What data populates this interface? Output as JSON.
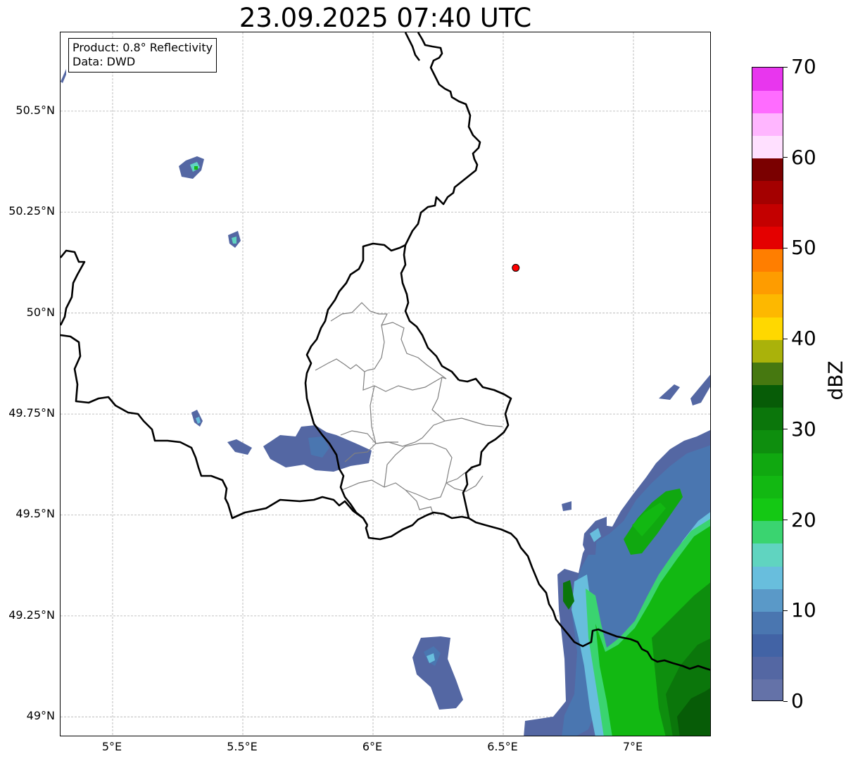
{
  "title": "23.09.2025 07:40 UTC",
  "info_box": {
    "product": "Product: 0.8° Reflectivity",
    "data": "Data: DWD"
  },
  "map": {
    "extent": {
      "lon": [
        4.8,
        7.3
      ],
      "lat": [
        48.95,
        50.695
      ]
    },
    "lat_ticks": [
      {
        "value": 50.5,
        "label": "50.5°N"
      },
      {
        "value": 50.25,
        "label": "50.25°N"
      },
      {
        "value": 50.0,
        "label": "50°N"
      },
      {
        "value": 49.75,
        "label": "49.75°N"
      },
      {
        "value": 49.5,
        "label": "49.5°N"
      },
      {
        "value": 49.25,
        "label": "49.25°N"
      },
      {
        "value": 49.0,
        "label": "49°N"
      }
    ],
    "lon_ticks": [
      {
        "value": 5.0,
        "label": "5°E"
      },
      {
        "value": 5.5,
        "label": "5.5°E"
      },
      {
        "value": 6.0,
        "label": "6°E"
      },
      {
        "value": 6.5,
        "label": "6.5°E"
      },
      {
        "value": 7.0,
        "label": "7°E"
      }
    ],
    "gridlines": true,
    "marker": {
      "lon": 6.548,
      "lat": 50.112,
      "color": "#ff0000"
    }
  },
  "colorbar": {
    "unit": "dBZ",
    "min": 0,
    "max": 70,
    "step": 2.5,
    "colors": [
      "#6472a8",
      "#5467a3",
      "#4263a5",
      "#4a76b0",
      "#5a99c8",
      "#68bedd",
      "#60d4c0",
      "#3ad470",
      "#14c814",
      "#12b812",
      "#10a810",
      "#0e8e0e",
      "#0b760b",
      "#075c07",
      "#467810",
      "#aab20a",
      "#ffd800",
      "#fdb800",
      "#fe9c00",
      "#ff7e00",
      "#e40000",
      "#c40000",
      "#a40000",
      "#7a0000",
      "#ffe0ff",
      "#ffb6ff",
      "#ff6cff",
      "#e836ee"
    ],
    "ticks": [
      {
        "value": 0,
        "label": "0"
      },
      {
        "value": 10,
        "label": "10"
      },
      {
        "value": 20,
        "label": "20"
      },
      {
        "value": 30,
        "label": "30"
      },
      {
        "value": 40,
        "label": "40"
      },
      {
        "value": 50,
        "label": "50"
      },
      {
        "value": 60,
        "label": "60"
      },
      {
        "value": 70,
        "label": "70"
      }
    ]
  }
}
